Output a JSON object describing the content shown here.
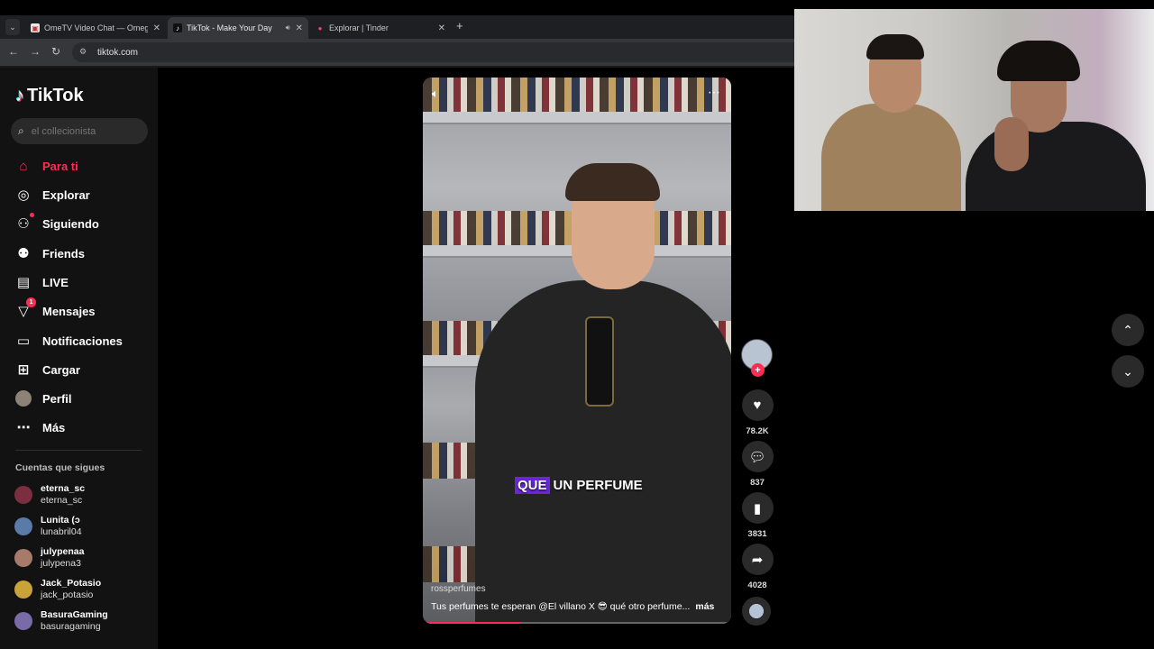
{
  "browser": {
    "tabs": [
      {
        "title": "OmeTV Video Chat — Omegle",
        "active": false,
        "audio": false
      },
      {
        "title": "TikTok - Make Your Day",
        "active": true,
        "audio": true
      },
      {
        "title": "Explorar | Tinder",
        "active": false,
        "audio": false
      }
    ],
    "new_tab_label": "+",
    "url": "tiktok.com"
  },
  "sidebar": {
    "logo_text": "TikTok",
    "search_placeholder": "el collecionista",
    "nav_items": [
      {
        "label": "Para ti",
        "icon": "home-icon",
        "active": true
      },
      {
        "label": "Explorar",
        "icon": "compass-icon",
        "active": false
      },
      {
        "label": "Siguiendo",
        "icon": "following-icon",
        "active": false,
        "dot": true
      },
      {
        "label": "Friends",
        "icon": "friends-icon",
        "active": false
      },
      {
        "label": "LIVE",
        "icon": "live-icon",
        "active": false
      },
      {
        "label": "Mensajes",
        "icon": "messages-icon",
        "active": false,
        "badge": "1"
      },
      {
        "label": "Notificaciones",
        "icon": "notifications-icon",
        "active": false
      },
      {
        "label": "Cargar",
        "icon": "upload-icon",
        "active": false
      },
      {
        "label": "Perfil",
        "icon": "profile-avatar",
        "active": false
      },
      {
        "label": "Más",
        "icon": "more-icon",
        "active": false
      }
    ],
    "following_title": "Cuentas que sigues",
    "following": [
      {
        "display": "eterna_sc",
        "handle": "eterna_sc",
        "color": "#7a2e3f"
      },
      {
        "display": "Lunita (ↄ",
        "handle": "lunabril04",
        "color": "#5a7aa8"
      },
      {
        "display": "julypenaa",
        "handle": "julypena3",
        "color": "#a87a6a"
      },
      {
        "display": "Jack_Potasio",
        "handle": "jack_potasio",
        "color": "#c9a23a"
      },
      {
        "display": "BasuraGaming",
        "handle": "basuragaming",
        "color": "#7a6aa8"
      }
    ]
  },
  "video": {
    "caption_highlight": "QUE",
    "caption_rest": "UN PERFUME",
    "author": "rossperfumes",
    "description": "Tus perfumes te esperan @El villano X  😎 qué otro perfume...",
    "more_label": "más",
    "progress": 0.32
  },
  "actions": {
    "likes": "78.2K",
    "comments": "837",
    "saves": "3831",
    "shares": "4028"
  },
  "colors": {
    "accent": "#fe2c55",
    "caption_highlight": "#6a27d6"
  }
}
